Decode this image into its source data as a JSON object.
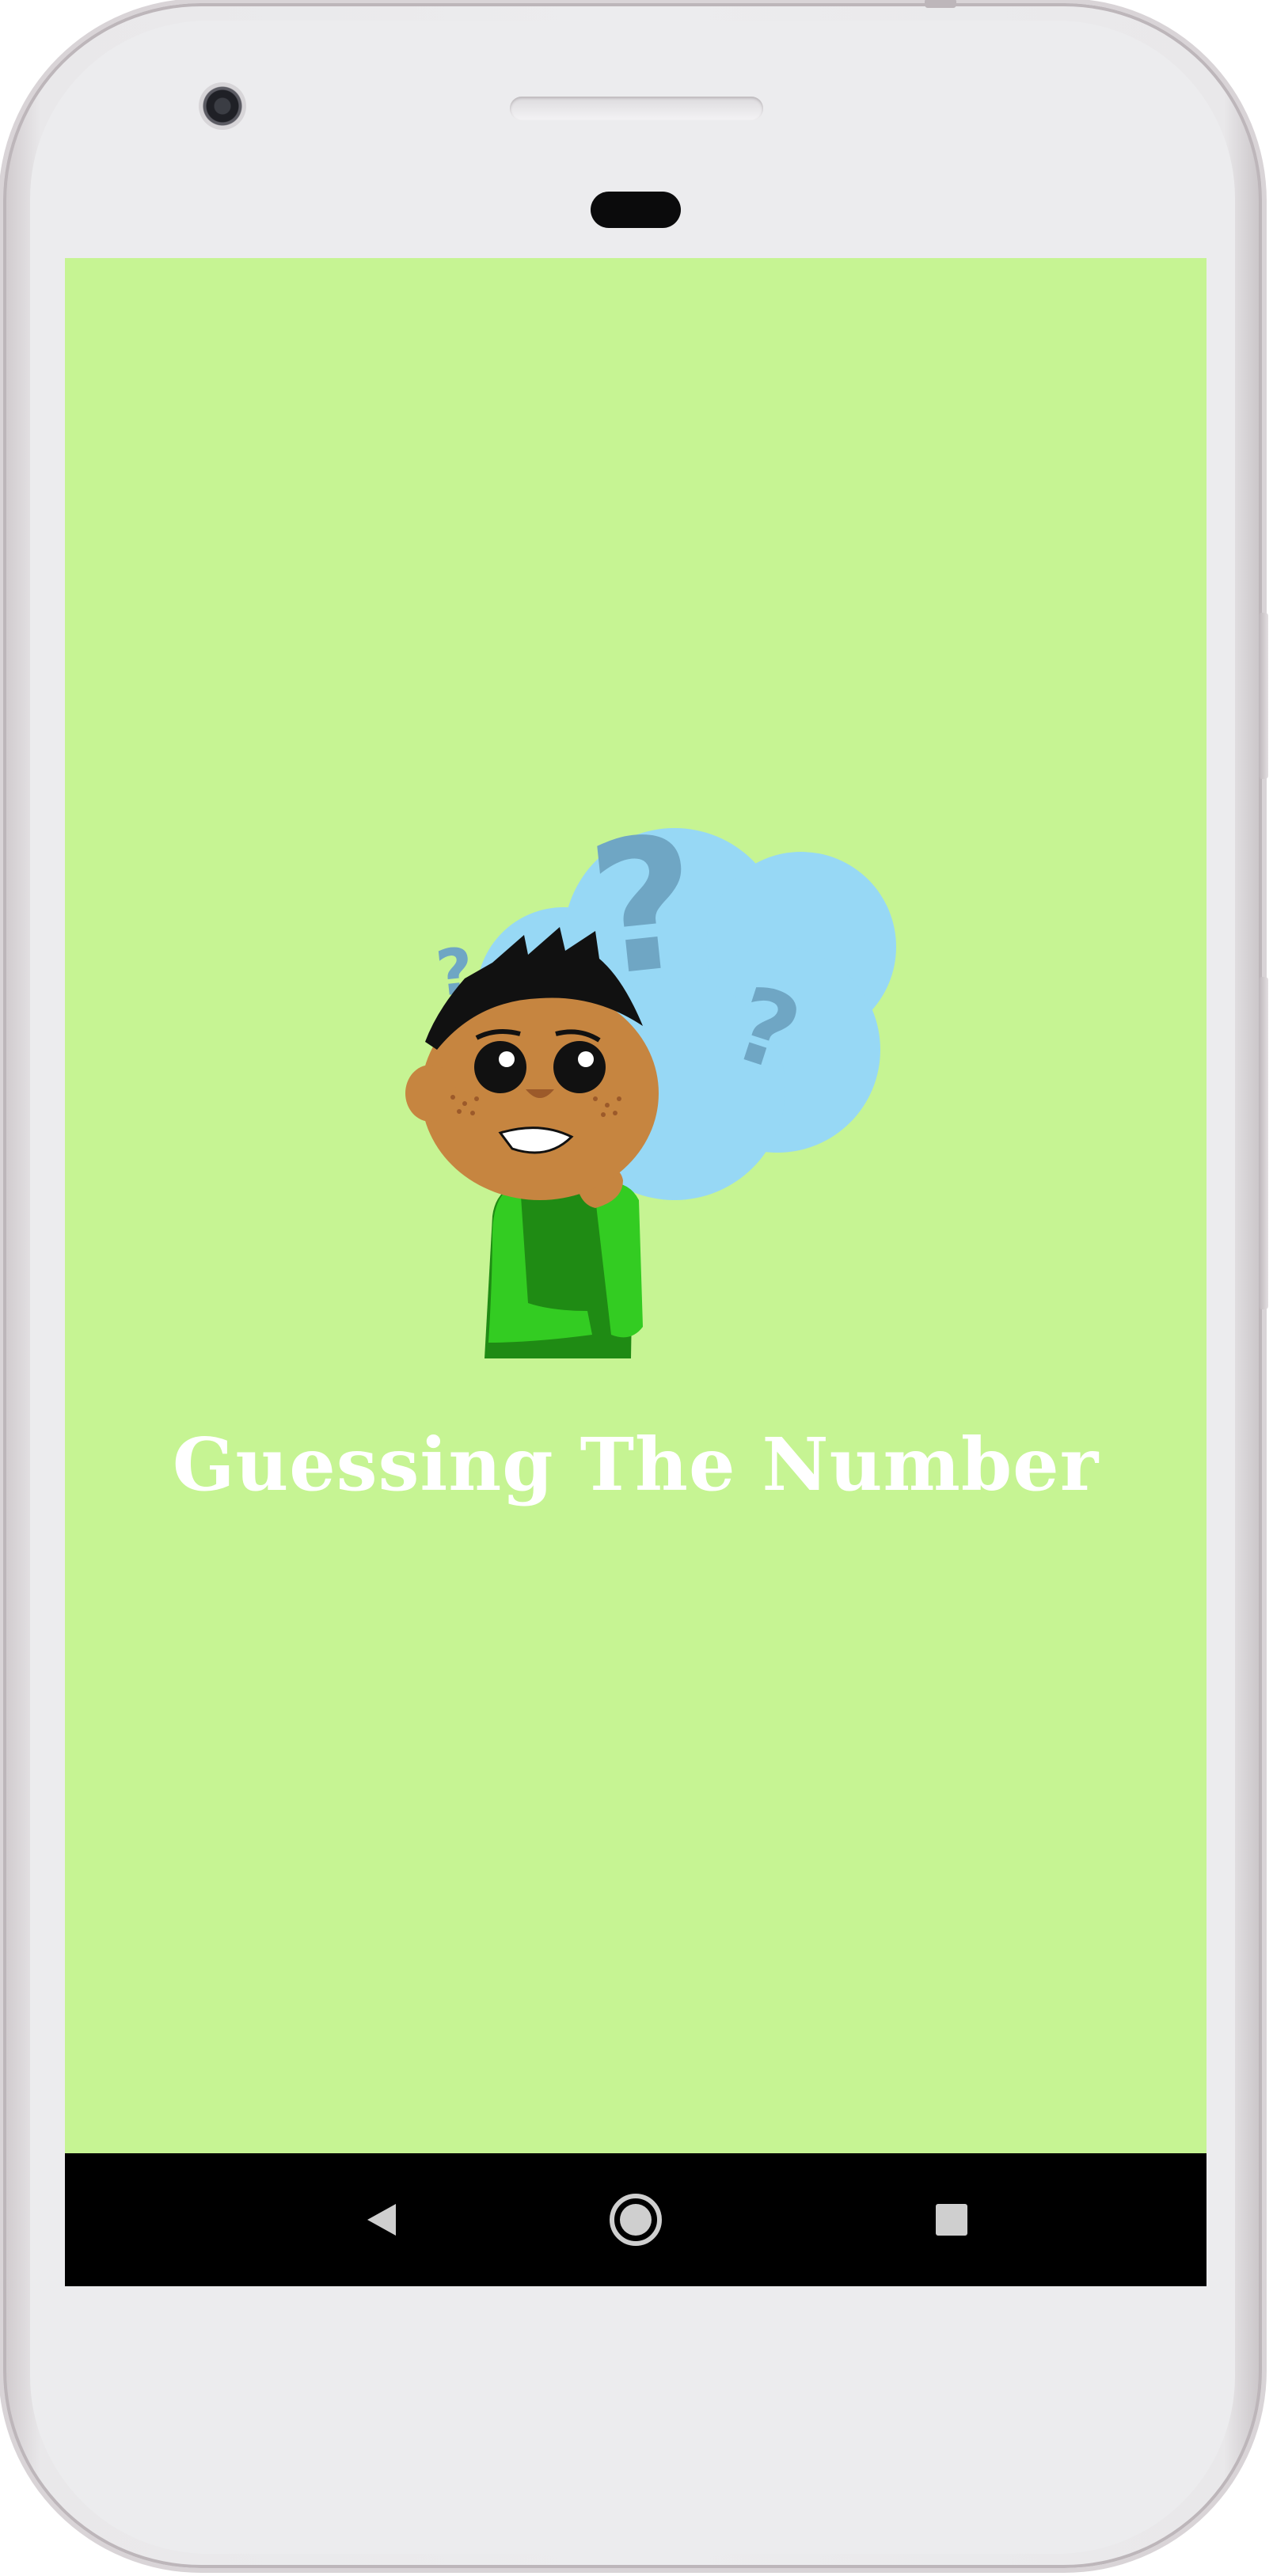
{
  "app": {
    "title": "Guessing The Number",
    "background_color": "#c6f493",
    "title_color": "#ffffff"
  },
  "illustration": {
    "icon": "thinking-boy-question-cloud",
    "cloud_color": "#97d8f5",
    "question_mark_color": "#6fa6c4"
  },
  "navigation_bar": {
    "back": "back-icon",
    "home": "home-icon",
    "recents": "recents-icon"
  }
}
